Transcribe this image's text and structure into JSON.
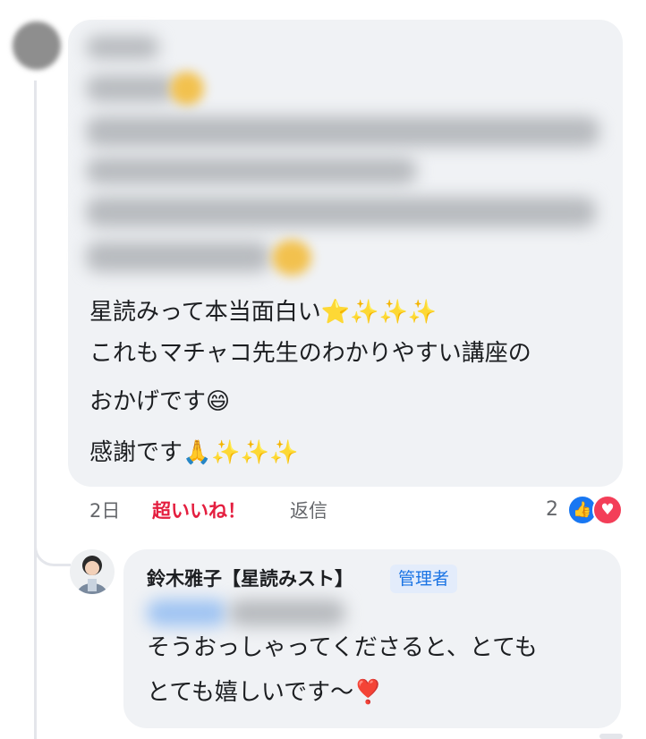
{
  "comment": {
    "lines": [
      "星読みって本当面白い⭐✨✨✨",
      "これもマチャコ先生のわかりやすい講座の",
      "おかげです😄",
      "感謝です🙏✨✨✨"
    ],
    "time": "2日",
    "reaction_label": "超いいね！",
    "reply_label": "返信",
    "reaction_count": "2",
    "reaction_icons": [
      "like-icon",
      "love-icon"
    ]
  },
  "reply": {
    "author": "鈴木雅子【星読みスト】",
    "badge": "管理者",
    "lines": [
      "そうおっしゃってくださると、とても",
      "とても嬉しいです〜❣️"
    ]
  },
  "colors": {
    "bubble": "#f0f2f5",
    "super_like": "#e41e3f",
    "like_blue": "#1877f2",
    "love_red": "#f33e58",
    "badge_bg": "#e3ecfb",
    "badge_text": "#1b74e4"
  }
}
